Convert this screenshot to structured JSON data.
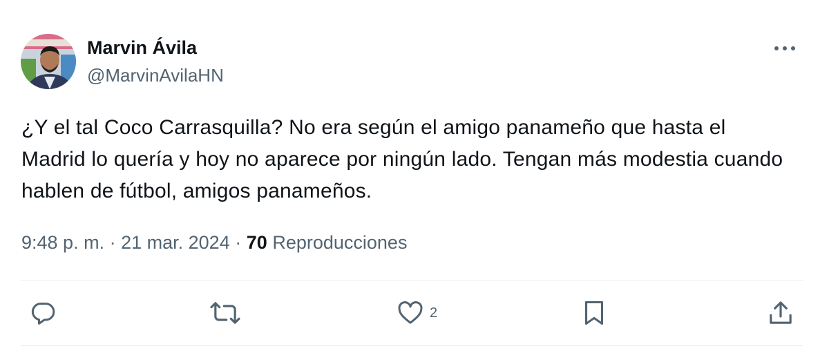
{
  "author": {
    "display_name": "Marvin Ávila",
    "handle": "@MarvinAvilaHN"
  },
  "tweet": {
    "text": "¿Y el tal Coco Carrasquilla? No era según el amigo panameño que hasta el Madrid lo quería y hoy no aparece por ningún lado. Tengan más modestia cuando hablen de fútbol, amigos panameños."
  },
  "meta": {
    "time": "9:48 p. m.",
    "separator": "·",
    "date": "21 mar. 2024",
    "views_count": "70",
    "views_label": "Reproducciones"
  },
  "actions": {
    "reply_icon": "reply-icon",
    "retweet_icon": "retweet-icon",
    "like_icon": "heart-icon",
    "like_count": "2",
    "bookmark_icon": "bookmark-icon",
    "share_icon": "share-icon",
    "more_icon": "more-horizontal-icon"
  },
  "colors": {
    "text_primary": "#0f1419",
    "text_secondary": "#536471",
    "divider": "#e6ecf0"
  }
}
